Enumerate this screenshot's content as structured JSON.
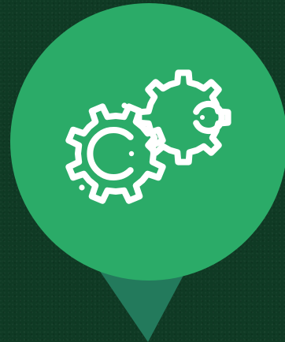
{
  "colors": {
    "background": "#0f3a24",
    "pin_circle": "#2bab68",
    "pin_pointer": "#237a5c",
    "icon_stroke": "#ffffff"
  },
  "icons": {
    "main": "gears-icon",
    "gear_large": "gear-icon",
    "gear_small": "gear-icon"
  }
}
